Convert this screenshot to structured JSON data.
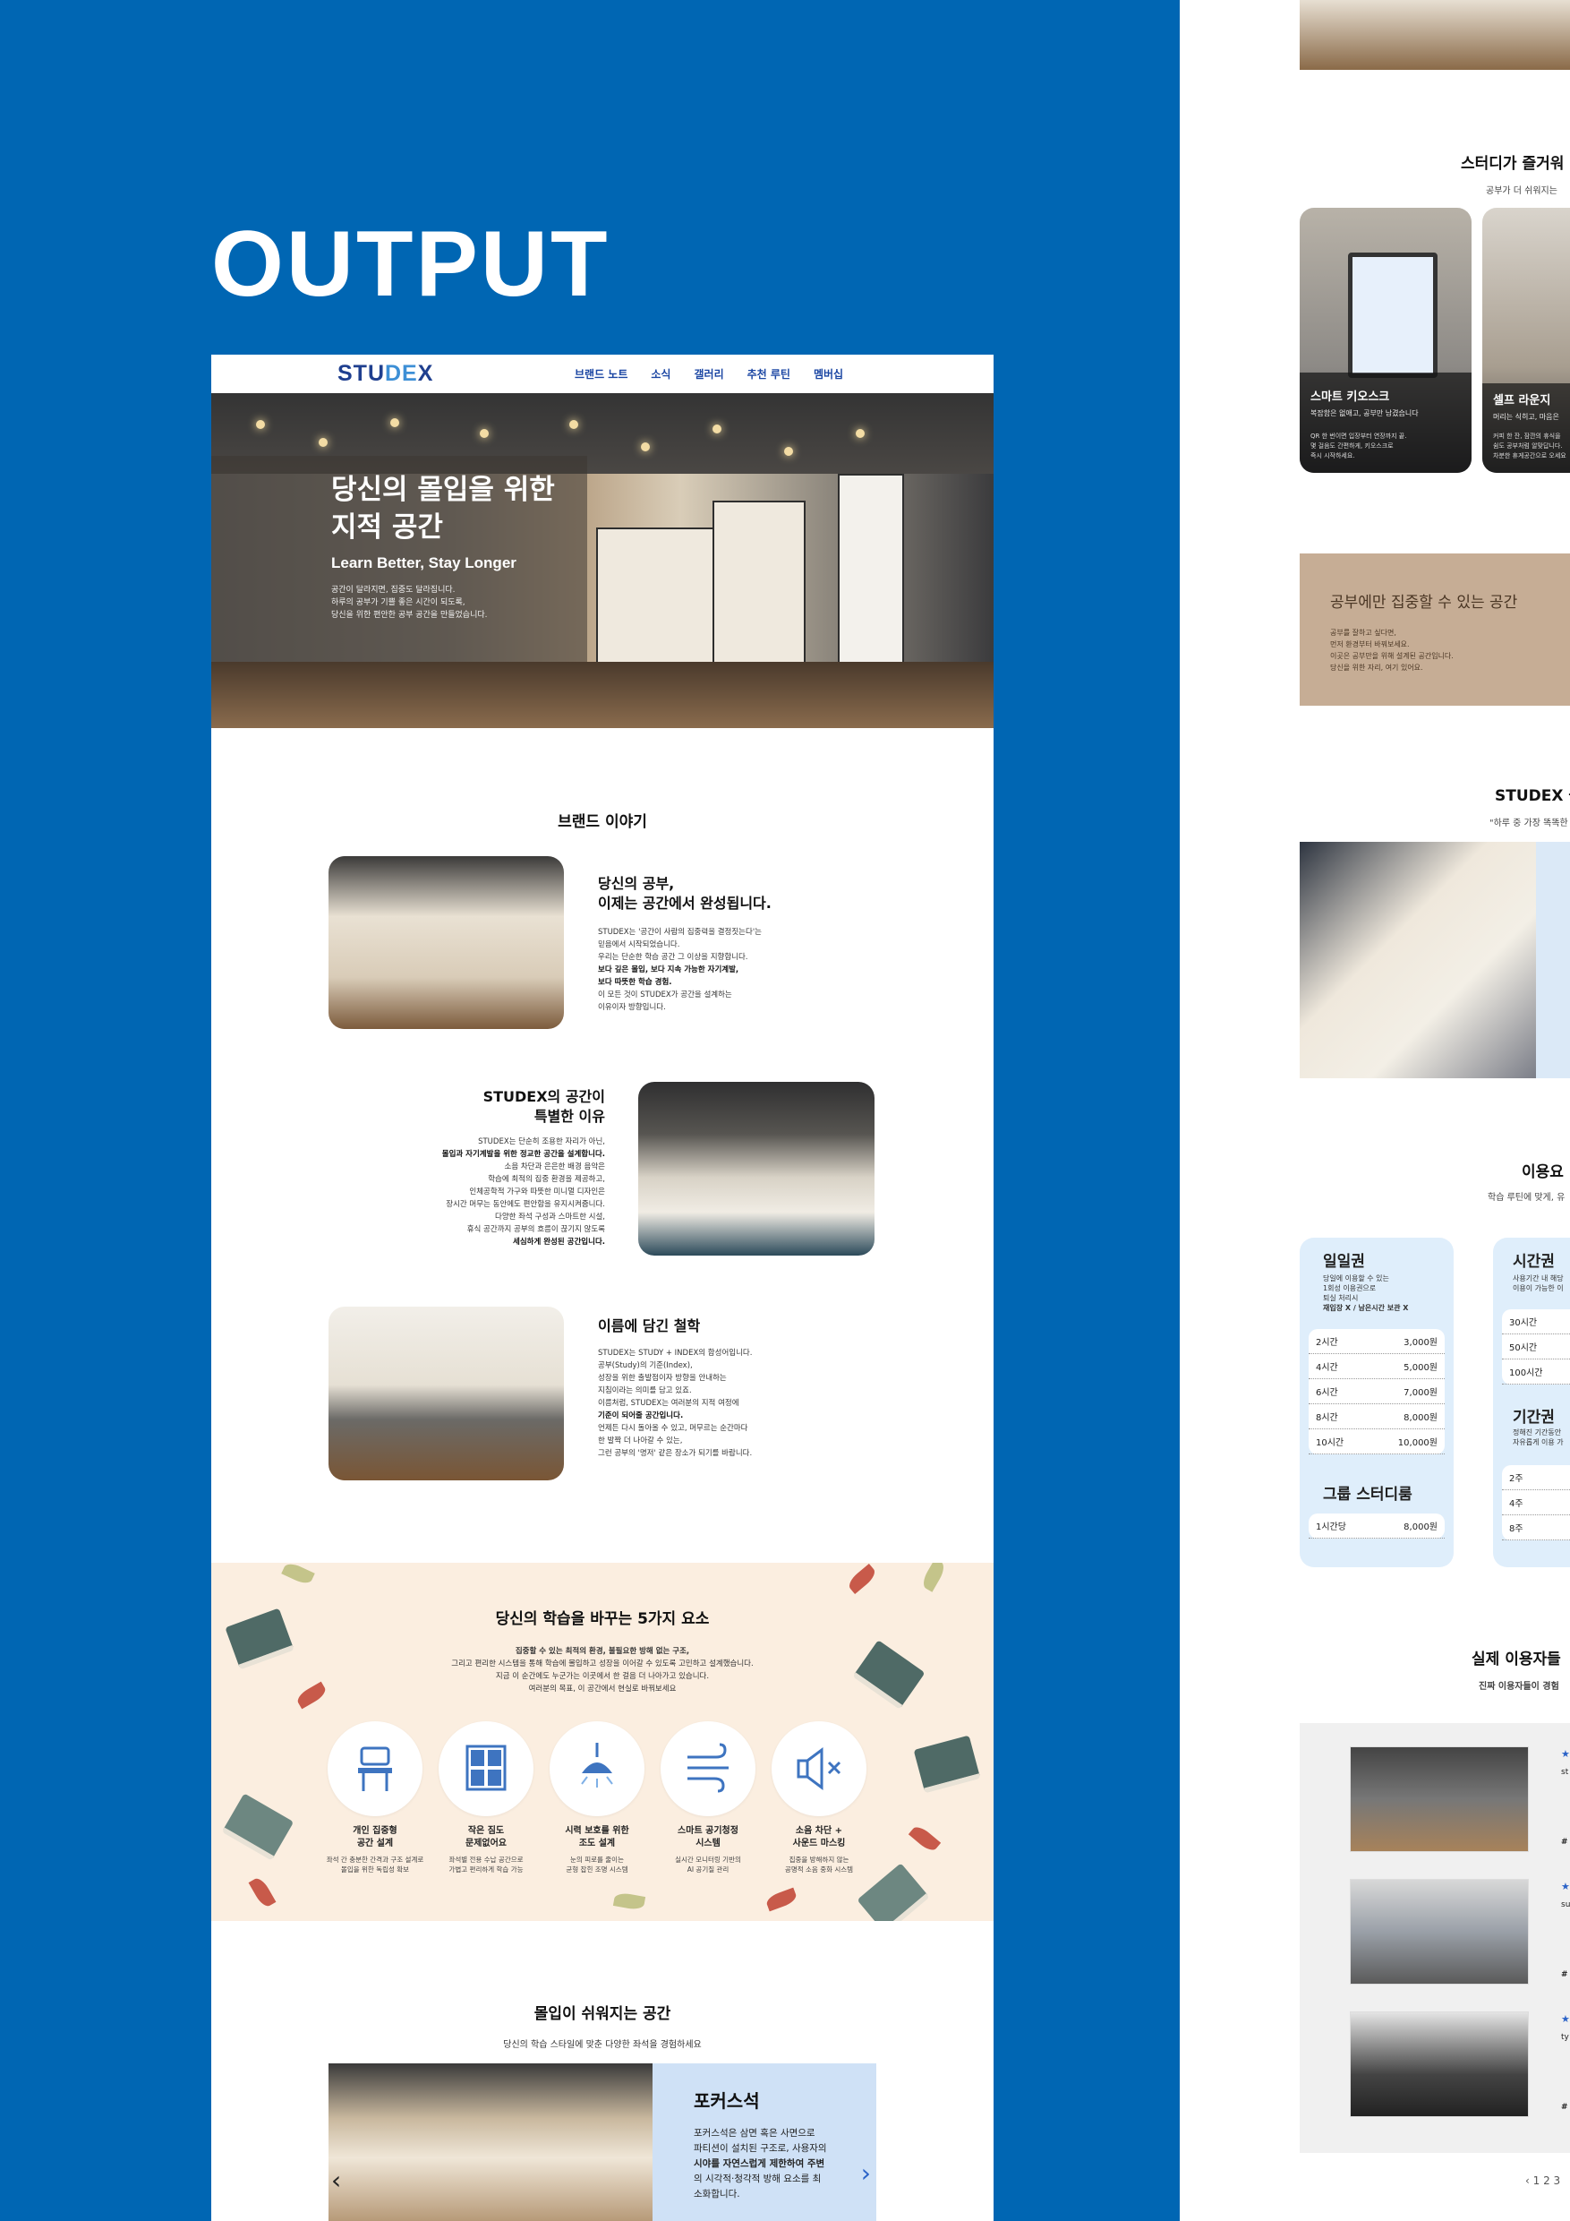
{
  "header": {
    "title": "OUTPUT"
  },
  "site": {
    "logo": "STUDEX",
    "nav": [
      "브랜드 노트",
      "소식",
      "갤러리",
      "추천 루틴",
      "멤버십"
    ]
  },
  "hero": {
    "title_line1": "당신의 몰입을 위한",
    "title_line2": "지적 공간",
    "subtitle": "Learn Better, Stay Longer",
    "desc_line1": "공간이 달라지면, 집중도 달라집니다.",
    "desc_line2": "하루의 공부가 기쁠 좋은 시간이 되도록,",
    "desc_line3": "당신을 위한 편안한 공부 공간을 만들었습니다."
  },
  "brand": {
    "section_title": "브랜드 이야기",
    "block1": {
      "title_line1": "당신의 공부,",
      "title_line2": "이제는 공간에서 완성됩니다.",
      "lines": [
        "STUDEX는 '공간이 사람의 집중력을 결정짓는다'는",
        "믿음에서 시작되었습니다.",
        "우리는 단순한 학습 공간 그 이상을 지향합니다.",
        "보다 깊은 몰입, 보다 지속 가능한 자기계발,",
        "보다 따뜻한 학습 경험.",
        "이 모든 것이 STUDEX가 공간을 설계하는",
        "이유이자 방향입니다."
      ]
    },
    "block2": {
      "title_line1": "STUDEX의 공간이",
      "title_line2": "특별한 이유",
      "lines": [
        "STUDEX는 단순히 조용한 자리가 아닌,",
        "몰입과 자기계발을 위한 정교한 공간을 설계합니다.",
        "소음 차단과 은은한 배경 음악은",
        "학습에 최적의 집중 환경을 제공하고,",
        "인체공학적 가구와 따뜻한 미니멀 디자인은",
        "장시간 머무는 동안에도 편안함을 유지시켜줍니다.",
        "다양한 좌석 구성과 스마트한 시설,",
        "휴식 공간까지 공부의 흐름이 끊기지 않도록",
        "세심하게 완성된 공간입니다."
      ]
    },
    "block3": {
      "title": "이름에 담긴 철학",
      "lines": [
        "STUDEX는 STUDY + INDEX의 합성어입니다.",
        "공부(Study)의 기준(Index),",
        "성장을 위한 출발점이자 방향을 안내하는",
        "지침이라는 의미를 담고 있죠.",
        "이름처럼, STUDEX는 여러분의 지적 여정에",
        "기준이 되어줄 공간입니다.",
        "언제든 다시 돌아올 수 있고, 머무르는 순간마다",
        "한 발짝 더 나아갈 수 있는,",
        "그런 공부의 '명저' 같은 장소가 되기를 바랍니다."
      ]
    }
  },
  "elements": {
    "title": "당신의 학습을 바꾸는 5가지 요소",
    "intro_lines": [
      "집중할 수 있는 최적의 환경, 불필요한 방해 없는 구조,",
      "그리고 편리한 시스템을 통해 학습에 몰입하고 성장을 이어갈 수 있도록 고민하고 설계했습니다.",
      "지금 이 순간에도 누군가는 이곳에서 한 걸음 더 나아가고 있습니다.",
      "여러분의 목표, 이 공간에서 현실로 바꿔보세요"
    ],
    "items": [
      {
        "icon": "desk-chair-icon",
        "title1": "개인 집중형",
        "title2": "공간 설계",
        "d1": "좌석 간 충분한 간격과 구조 설계로",
        "d2": "몰입을 위한 독립성 확보"
      },
      {
        "icon": "locker-icon",
        "title1": "작은 짐도",
        "title2": "문제없어요",
        "d1": "좌석별 전용 수납 공간으로",
        "d2": "가볍고 편리하게 학습 가능"
      },
      {
        "icon": "lamp-icon",
        "title1": "시력 보호를 위한",
        "title2": "조도 설계",
        "d1": "눈의 피로를 줄이는",
        "d2": "균형 잡힌 조명 시스템"
      },
      {
        "icon": "air-purifier-icon",
        "title1": "스마트 공기청정",
        "title2": "시스템",
        "d1": "실시간 모니터링 기반의",
        "d2": "AI 공기질 관리"
      },
      {
        "icon": "speaker-mute-icon",
        "title1": "소음 차단 +",
        "title2": "사운드 마스킹",
        "d1": "집중을 방해하지 않는",
        "d2": "공명적 소음 중화 시스템"
      }
    ]
  },
  "immersion": {
    "title": "몰입이 쉬워지는 공간",
    "subtitle": "당신의 학습 스타일에 맞춘 다양한 좌석을 경험하세요",
    "card_title": "포커스석",
    "card_lines": [
      "포커스석은 삼면 혹은 사면으로",
      "파티션이 설치된 구조로, 사용자의",
      "시야를 자연스럽게 제한하여 주변",
      "의 시각적·청각적 방해 요소를 최",
      "소화합니다."
    ],
    "prev": "‹",
    "next": "›"
  },
  "right": {
    "fun_title": "스터디가 즐거워",
    "fun_sub": "공부가 더 쉬워지는",
    "kiosk_title": "스마트 키오스크",
    "kiosk_sub": "복잡함은 없애고, 공부만 남겼습니다",
    "kiosk_lines": [
      "QR 한 번이면 입장부터 연장까지 끝.",
      "몇 걸음도 간편하게, 키오스크로",
      "즉시 시작하세요."
    ],
    "lounge_title": "셀프 라운지",
    "lounge_sub": "머리는 식히고, 마음은",
    "lounge_lines": [
      "커피 한 잔, 잠깐의 휴식을",
      "쉼도 공부처럼 알맞답니다.",
      "차분한 휴게공간으로 오세요"
    ],
    "banner_title": "공부에만 집중할 수 있는 공간",
    "banner_lines": [
      "공부를 잘하고 싶다면,",
      "먼저 환경부터 바꿔보세요.",
      "이곳은 공부만을 위해 설계된 공간입니다.",
      "당신을 위한 자리, 여기 있어요."
    ],
    "routine_title": "STUDEX 몰",
    "routine_sub": "\"하루 중 가장 똑똑한",
    "price_title": "이용요",
    "price_sub": "학습 루틴에 맞게, 유",
    "daily": {
      "title": "일일권",
      "desc_lines": [
        "당일에 이용할 수 있는",
        "1회성 이용권으로",
        "퇴실 처리시",
        "재입장 X / 남은시간 보관 X"
      ],
      "rows": [
        [
          "2시간",
          "3,000원"
        ],
        [
          "4시간",
          "5,000원"
        ],
        [
          "6시간",
          "7,000원"
        ],
        [
          "8시간",
          "8,000원"
        ],
        [
          "10시간",
          "10,000원"
        ]
      ]
    },
    "group": {
      "title": "그룹 스터디룸",
      "rows": [
        [
          "1시간당",
          "8,000원"
        ]
      ]
    },
    "hourly": {
      "title": "시간권",
      "desc_lines": [
        "사용기간 내 해당",
        "이용이 가능한 이"
      ],
      "rows": [
        [
          "30시간",
          ""
        ],
        [
          "50시간",
          ""
        ],
        [
          "100시간",
          ""
        ]
      ]
    },
    "period": {
      "title": "기간권",
      "desc_lines": [
        "정해진 기간동안",
        "자유롭게 이용 가"
      ],
      "rows": [
        [
          "2주",
          ""
        ],
        [
          "4주",
          ""
        ],
        [
          "8주",
          ""
        ]
      ]
    },
    "review_title": "실제 이용자들",
    "review_sub": "진짜 이용자들이 경험",
    "reviews": [
      {
        "stars": "★",
        "name": "st",
        "tag": "#"
      },
      {
        "stars": "★",
        "name": "su",
        "tag": "#"
      },
      {
        "stars": "★",
        "name": "ty",
        "tag": "#"
      }
    ],
    "pager": "‹ 1  2  3"
  }
}
